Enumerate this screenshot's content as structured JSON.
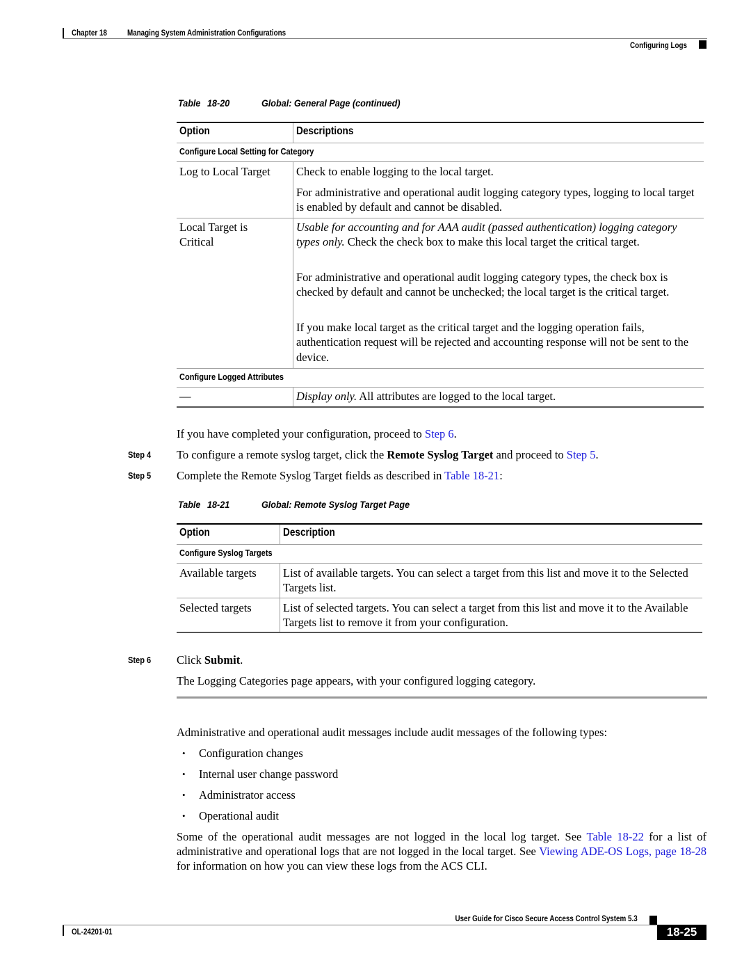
{
  "header": {
    "chapter": "Chapter 18",
    "chapter_title": "Managing System Administration Configurations",
    "section": "Configuring Logs"
  },
  "table1": {
    "caption_label": "Table",
    "caption_number": "18-20",
    "caption_title": "Global: General Page (continued)",
    "col_option": "Option",
    "col_desc": "Descriptions",
    "section1": "Configure Local Setting for Category",
    "rows": [
      {
        "option": "Log to Local Target",
        "desc": [
          "Check to enable logging to the local target.",
          "For administrative and operational audit logging category types, logging to local target is enabled by default and cannot be disabled."
        ]
      },
      {
        "option": "Local Target is Critical",
        "desc_italic": "Usable for accounting and for AAA audit (passed authentication) logging category types only.",
        "desc_rest": " Check the check box to make this local target the critical target.",
        "desc_more": [
          "For administrative and operational audit logging category types, the check box is checked by default and cannot be unchecked; the local target is the critical target.",
          "If you make local target as the critical target and the logging operation fails, authentication request will be rejected and accounting response will not be sent to the device."
        ]
      }
    ],
    "section2": "Configure Logged Attributes",
    "row3": {
      "option": "—",
      "desc_italic": "Display only.",
      "desc_rest": " All attributes are logged to the local target."
    }
  },
  "steps": {
    "intro_text": "If you have completed your configuration, proceed to ",
    "intro_link": "Step 6",
    "intro_end": ".",
    "step4": {
      "label": "Step 4",
      "text_a": "To configure a remote syslog target, click the ",
      "bold": "Remote Syslog Target",
      "text_b": " and proceed to ",
      "link": "Step 5",
      "text_c": "."
    },
    "step5": {
      "label": "Step 5",
      "text_a": "Complete the Remote Syslog Target fields as described in ",
      "link": "Table 18-21",
      "text_b": ":"
    },
    "step6": {
      "label": "Step 6",
      "text_a": "Click ",
      "bold": "Submit",
      "text_b": ".",
      "result": "The Logging Categories page appears, with your configured logging category."
    }
  },
  "table2": {
    "caption_label": "Table",
    "caption_number": "18-21",
    "caption_title": "Global: Remote Syslog Target Page",
    "col_option": "Option",
    "col_desc": "Description",
    "section1": "Configure Syslog Targets",
    "rows": [
      {
        "option": "Available targets",
        "desc": "List of available targets. You can select a target from this list and move it to the Selected Targets list."
      },
      {
        "option": "Selected targets",
        "desc": "List of selected targets. You can select a target from this list and move it to the Available Targets list to remove it from your configuration."
      }
    ]
  },
  "audit": {
    "intro": "Administrative and operational audit messages include audit messages of the following types:",
    "bullets": [
      "Configuration changes",
      "Internal user change password",
      "Administrator access",
      "Operational audit"
    ],
    "note_a": "Some of the operational audit messages are not logged in the local log target. See ",
    "note_link1": "Table 18-22",
    "note_b": " for a list of administrative and operational logs that are not logged in the local target. See ",
    "note_link2": "Viewing ADE-OS Logs, page 18-28",
    "note_c": " for information on how you can view these logs from the ACS CLI."
  },
  "footer": {
    "guide_title": "User Guide for Cisco Secure Access Control System 5.3",
    "doc_number": "OL-24201-01",
    "page_number": "18-25"
  }
}
